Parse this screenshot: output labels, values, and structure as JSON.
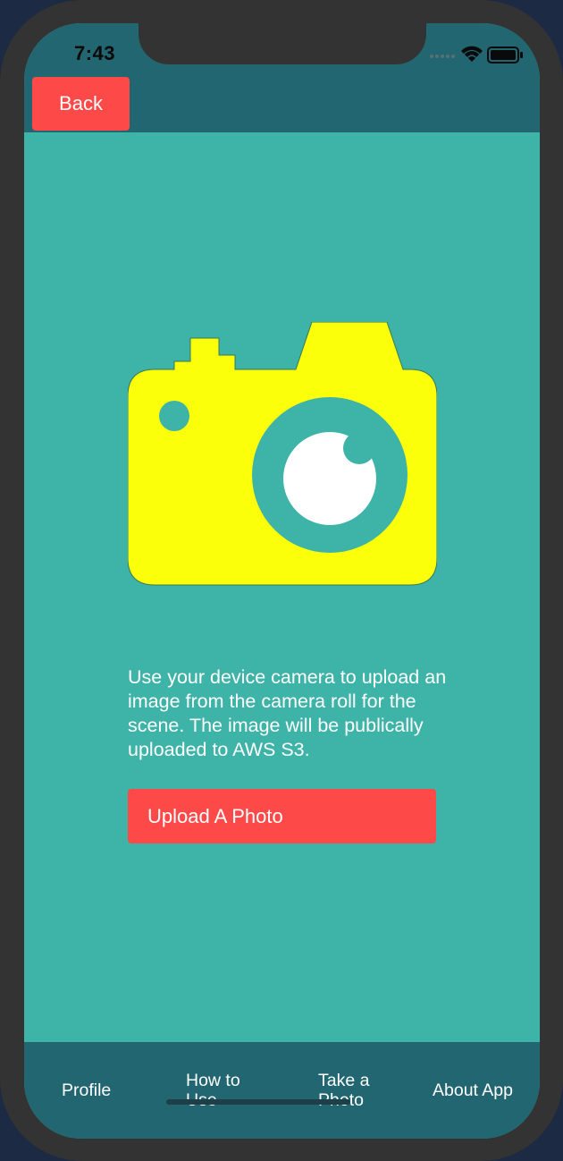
{
  "status_bar": {
    "time": "7:43",
    "icons": [
      "signal-dots-icon",
      "wifi-icon",
      "battery-icon"
    ]
  },
  "header": {
    "back_label": "Back"
  },
  "main": {
    "illustration": "camera-icon",
    "description": "Use your device camera to upload an image from the camera roll for the scene. The image will be publically uploaded to AWS S3.",
    "upload_label": "Upload A Photo"
  },
  "tab_bar": {
    "tabs": [
      {
        "line1": "Profile",
        "line2": ""
      },
      {
        "line1": "How to",
        "line2": "Use"
      },
      {
        "line1": "Take a",
        "line2": "Photo"
      },
      {
        "line1": "About App",
        "line2": ""
      }
    ]
  },
  "colors": {
    "background": "#3eb3a8",
    "bar": "#226671",
    "accent": "#fe4949",
    "camera": "#fbff0a"
  }
}
